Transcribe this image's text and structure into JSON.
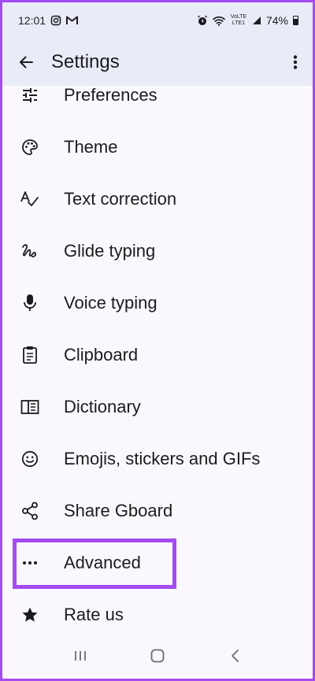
{
  "status_bar": {
    "time": "12:01",
    "battery": "74%",
    "network": "VoLTE LTE1"
  },
  "header": {
    "title": "Settings"
  },
  "settings_items": [
    {
      "label": "Preferences",
      "icon": "sliders-icon"
    },
    {
      "label": "Theme",
      "icon": "palette-icon"
    },
    {
      "label": "Text correction",
      "icon": "spellcheck-icon"
    },
    {
      "label": "Glide typing",
      "icon": "gesture-icon"
    },
    {
      "label": "Voice typing",
      "icon": "microphone-icon"
    },
    {
      "label": "Clipboard",
      "icon": "clipboard-icon"
    },
    {
      "label": "Dictionary",
      "icon": "book-icon"
    },
    {
      "label": "Emojis, stickers and GIFs",
      "icon": "smiley-icon"
    },
    {
      "label": "Share Gboard",
      "icon": "share-icon"
    },
    {
      "label": "Advanced",
      "icon": "more-horiz-icon",
      "highlighted": true
    },
    {
      "label": "Rate us",
      "icon": "star-icon"
    }
  ],
  "colors": {
    "highlight_border": "#a54bf2",
    "app_bar_bg": "#e9ecf7",
    "page_bg": "#fbf8fd",
    "text": "#1b1b1f"
  }
}
